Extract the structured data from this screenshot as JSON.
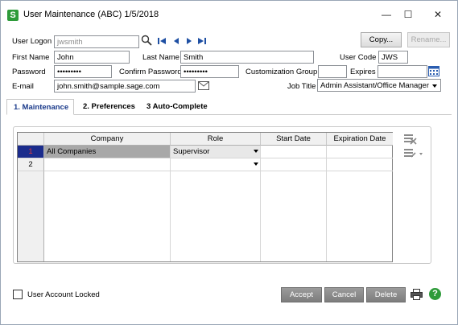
{
  "window": {
    "app_icon": "S",
    "title": "User Maintenance (ABC) 1/5/2018",
    "minimize": "—",
    "maximize": "☐",
    "close": "✕"
  },
  "header": {
    "user_logon_label": "User Logon",
    "user_logon_value": "jwsmith",
    "copy_button": "Copy...",
    "rename_button": "Rename...",
    "first_name_label": "First Name",
    "first_name_value": "John",
    "last_name_label": "Last Name",
    "last_name_value": "Smith",
    "user_code_label": "User Code",
    "user_code_value": "JWS",
    "password_label": "Password",
    "password_value": "•••••••••",
    "confirm_password_label": "Confirm Password",
    "confirm_password_value": "•••••••••",
    "customization_group_label": "Customization Group",
    "customization_group_value": "",
    "expires_label": "Expires",
    "expires_value": "",
    "email_label": "E-mail",
    "email_value": "john.smith@sample.sage.com",
    "job_title_label": "Job Title",
    "job_title_value": "Admin Assistant/Office Manager"
  },
  "tabs": [
    {
      "label": "1. Maintenance",
      "active": true
    },
    {
      "label": "2. Preferences",
      "active": false
    },
    {
      "label": "3 Auto-Complete",
      "active": false
    }
  ],
  "grid": {
    "columns": [
      "Company",
      "Role",
      "Start Date",
      "Expiration Date"
    ],
    "rows": [
      {
        "num": "1",
        "company": "All Companies",
        "role": "Supervisor",
        "start_date": "",
        "expiration_date": ""
      },
      {
        "num": "2",
        "company": "",
        "role": "",
        "start_date": "",
        "expiration_date": ""
      }
    ]
  },
  "footer": {
    "account_locked_label": "User Account Locked",
    "accept_button": "Accept",
    "cancel_button": "Cancel",
    "delete_button": "Delete",
    "help_glyph": "?"
  },
  "colors": {
    "accent_green": "#2e9b3a",
    "selected_row": "#1b2c8c",
    "tab_active_text": "#1a3a8a"
  }
}
